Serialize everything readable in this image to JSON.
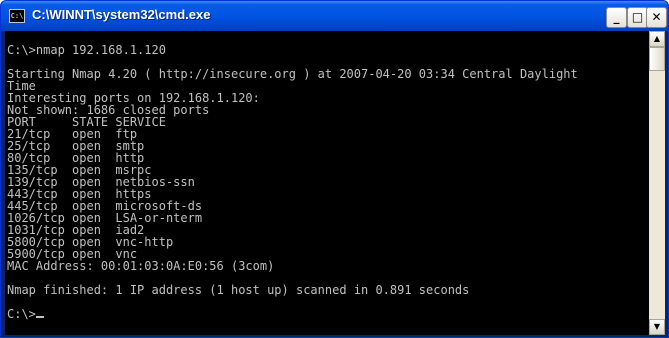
{
  "window": {
    "title": "C:\\WINNT\\system32\\cmd.exe",
    "icon_text": "C:\\",
    "controls": {
      "minimize": "_",
      "maximize": "□",
      "close": "✕"
    }
  },
  "console": {
    "lines": [
      "C:\\>nmap 192.168.1.120",
      "",
      "Starting Nmap 4.20 ( http://insecure.org ) at 2007-04-20 03:34 Central Daylight",
      "Time",
      "Interesting ports on 192.168.1.120:",
      "Not shown: 1686 closed ports",
      "PORT     STATE SERVICE",
      "21/tcp   open  ftp",
      "25/tcp   open  smtp",
      "80/tcp   open  http",
      "135/tcp  open  msrpc",
      "139/tcp  open  netbios-ssn",
      "443/tcp  open  https",
      "445/tcp  open  microsoft-ds",
      "1026/tcp open  LSA-or-nterm",
      "1031/tcp open  iad2",
      "5800/tcp open  vnc-http",
      "5900/tcp open  vnc",
      "MAC Address: 00:01:03:0A:E0:56 (3com)",
      "",
      "Nmap finished: 1 IP address (1 host up) scanned in 0.891 seconds",
      "",
      "C:\\>"
    ]
  },
  "scrollbar": {
    "up": "▲",
    "down": "▼"
  },
  "colors": {
    "titlebar": "#0054e3",
    "console_bg": "#000000",
    "console_text": "#c0c0c0"
  }
}
